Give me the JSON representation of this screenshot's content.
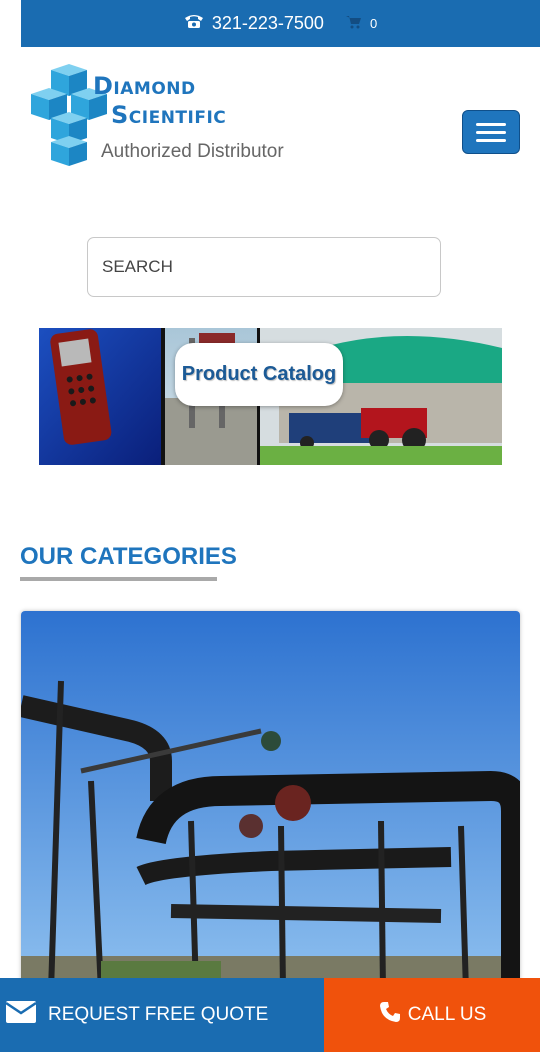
{
  "topbar": {
    "phone": "321-223-7500",
    "cart_count": "0"
  },
  "logo": {
    "line1": "Diamond",
    "line2": "Scientific",
    "tagline": "Authorized Distributor"
  },
  "search": {
    "placeholder": "SEARCH"
  },
  "banner": {
    "button_label": "Product Catalog"
  },
  "categories": {
    "title": "OUR CATEGORIES"
  },
  "bottom_bar": {
    "quote_label": "REQUEST FREE QUOTE",
    "call_label": "CALL US"
  },
  "colors": {
    "brand_blue": "#1a6cb1",
    "call_orange": "#f0520c"
  }
}
